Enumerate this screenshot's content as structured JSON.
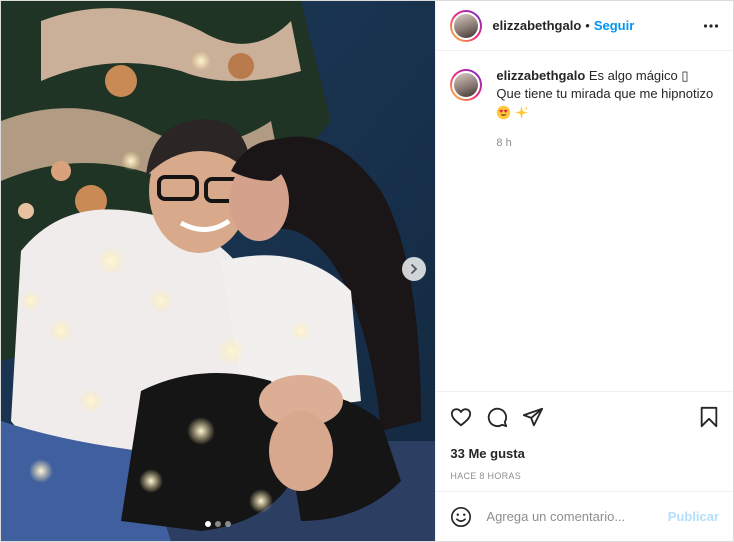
{
  "post": {
    "username": "elizzabethgalo",
    "separator": "•",
    "follow_label": "Seguir",
    "caption_line1": "Es algo mágico ",
    "caption_unknown_glyph": "▯",
    "caption_line2": "Que tiene tu mirada que me hipnotizo",
    "caption_emojis": [
      "heart-eyes-emoji",
      "sparkles-emoji"
    ],
    "caption_age": "8 h",
    "likes_text": "33 Me gusta",
    "timestamp_text": "HACE 8 HORAS",
    "comment_placeholder": "Agrega un comentario...",
    "publish_label": "Publicar",
    "carousel": {
      "total": 3,
      "active": 1
    }
  },
  "icons": {
    "more": "more-horizontal-icon",
    "like": "heart-icon",
    "comment": "comment-bubble-icon",
    "share": "paper-plane-icon",
    "save": "bookmark-icon",
    "emoji": "smiley-icon",
    "next": "chevron-right-icon"
  },
  "colors": {
    "link_blue": "#0095f6",
    "publish_disabled": "#b2dffc",
    "secondary_text": "#8e8e8e",
    "border": "#efefef"
  }
}
